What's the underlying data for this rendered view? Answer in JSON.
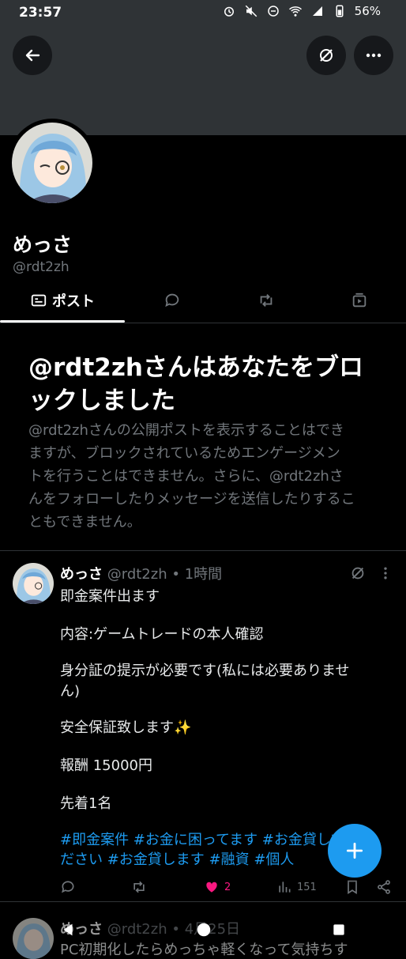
{
  "status_bar": {
    "time": "23:57",
    "battery": "56%"
  },
  "profile": {
    "name": "めっさ",
    "handle": "@rdt2zh"
  },
  "tabs": [
    {
      "label": "ポスト",
      "icon": "posts-icon",
      "active": true
    },
    {
      "label": "",
      "icon": "replies-icon"
    },
    {
      "label": "",
      "icon": "retweets-icon"
    },
    {
      "label": "",
      "icon": "media-icon"
    }
  ],
  "block_notice": {
    "title_line1": "@rdt2zhさんはあなたをブロ",
    "title_line2": "ックしました",
    "body_line1": "@rdt2zhさんの公開ポストを表示することはでき",
    "body_line2": "ますが、ブロックされているためエンゲージメン",
    "body_line3": "トを行うことはできません。さらに、@rdt2zhさ",
    "body_line4": "んをフォローしたりメッセージを送信したりするこ",
    "body_line5": "ともできません。"
  },
  "tweet": {
    "name": "めっさ",
    "handle": "@rdt2zh",
    "time": "• 1時間",
    "lines": [
      "即金案件出ます",
      "内容:ゲームトレードの本人確認",
      "身分証の提示が必要です(私には必要ありませ",
      "ん)",
      "安全保証致します✨",
      "報酬 15000円",
      "先着1名"
    ],
    "tags_line1": "#即金案件 #お金に困ってます #お金貸してく",
    "tags_line2": "ださい #お金貸します #融資 #個人",
    "likes": "2",
    "views": "151",
    "like_color": "#f91880"
  },
  "tweet2": {
    "name": "めっさ",
    "handle": "@rdt2zh",
    "time": "• 4月25日",
    "preview": "PC初期化したらめっちゃ軽くなって気持ちす"
  },
  "colors": {
    "accent": "#1d9bf0",
    "muted": "#71767b",
    "banner": "#2f3336"
  }
}
